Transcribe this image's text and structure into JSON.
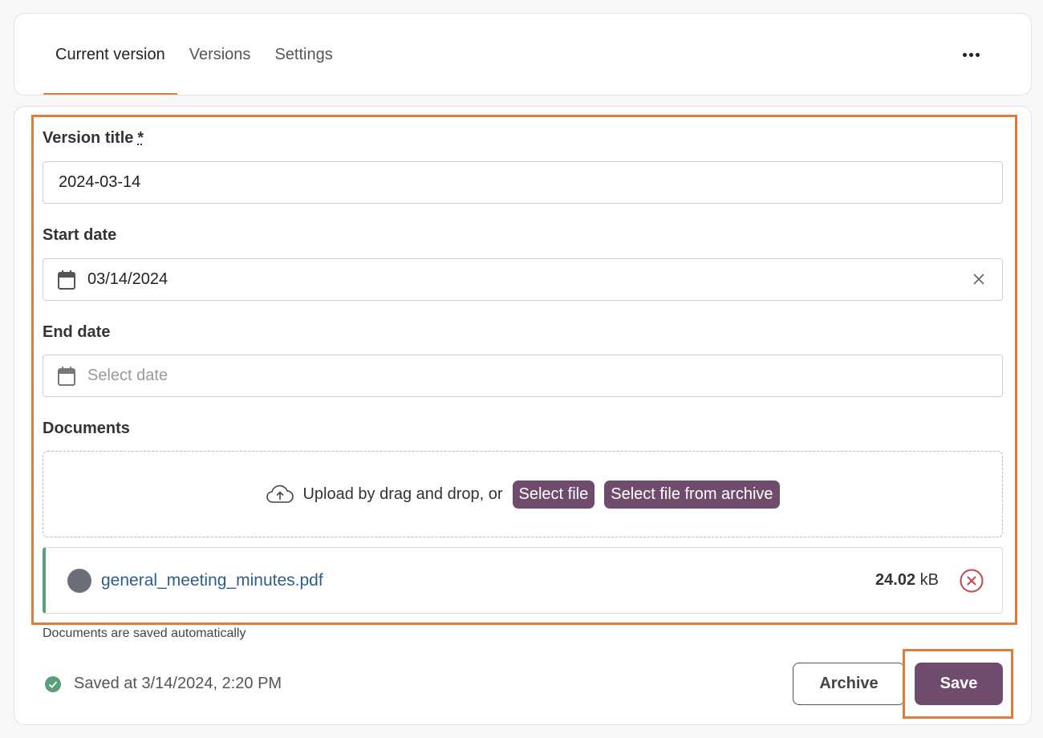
{
  "tabs": {
    "items": [
      {
        "label": "Current version"
      },
      {
        "label": "Versions"
      },
      {
        "label": "Settings"
      }
    ],
    "active_index": 0
  },
  "form": {
    "version_title": {
      "label": "Version title",
      "required_mark": "*",
      "value": "2024-03-14"
    },
    "start_date": {
      "label": "Start date",
      "value": "03/14/2024"
    },
    "end_date": {
      "label": "End date",
      "placeholder": "Select date"
    },
    "documents": {
      "label": "Documents",
      "upload_text": "Upload by drag and drop, or",
      "select_file_label": "Select file",
      "select_archive_label": "Select file from archive",
      "files": [
        {
          "name": "general_meeting_minutes.pdf",
          "size_value": "24.02",
          "size_unit": "kB"
        }
      ],
      "hint": "Documents are saved automatically"
    }
  },
  "footer": {
    "status_text": "Saved at 3/14/2024, 2:20 PM",
    "archive_label": "Archive",
    "save_label": "Save"
  },
  "colors": {
    "accent_orange": "#e07b3a",
    "primary_purple": "#6f4c6c",
    "success_green": "#5a9f7a",
    "danger_red": "#c0474a",
    "link_blue": "#2d5d8a"
  }
}
